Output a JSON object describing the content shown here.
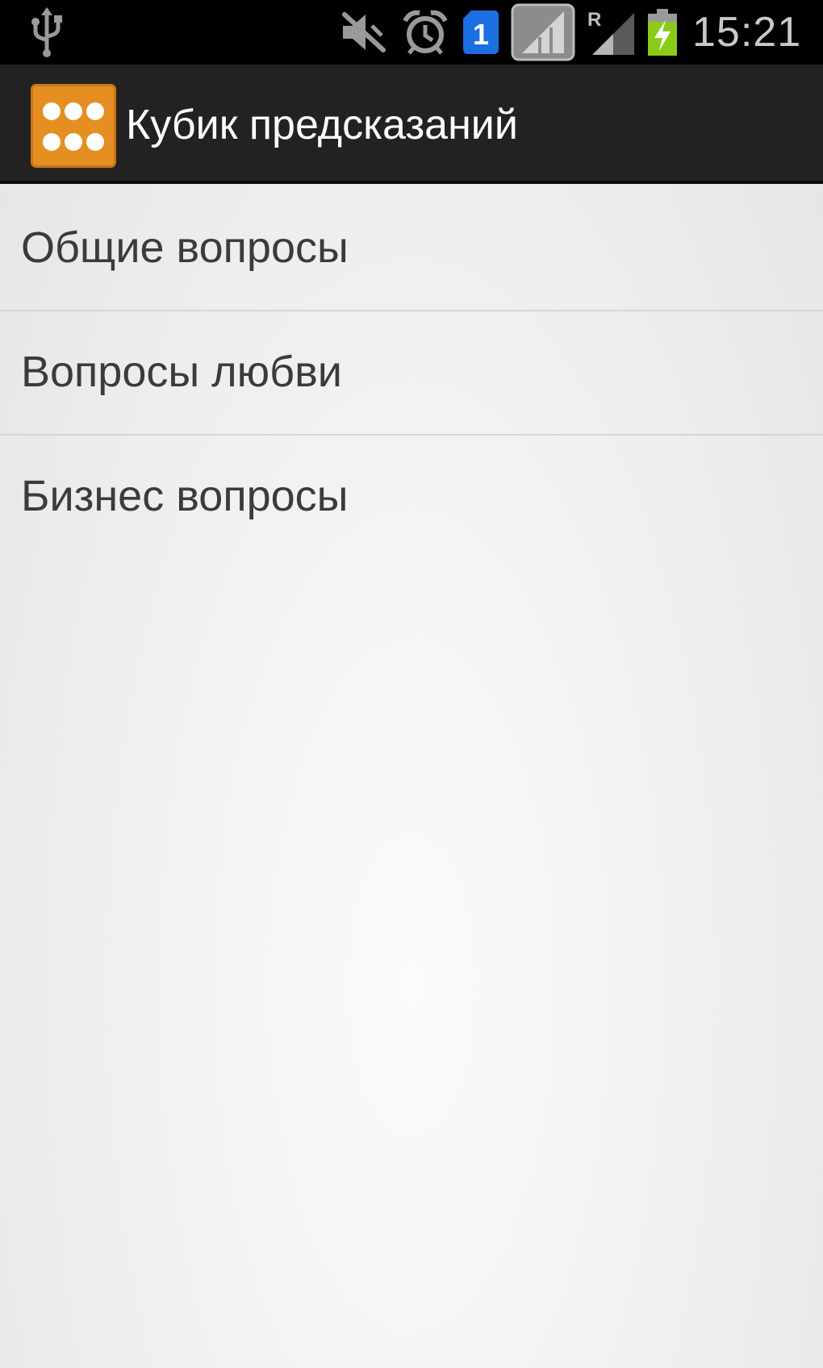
{
  "status_bar": {
    "icons": [
      "usb-icon",
      "mute-icon",
      "alarm-icon",
      "sim-1-icon",
      "signal-icon",
      "signal-roaming-icon",
      "battery-charging-icon"
    ],
    "roaming_label": "R",
    "sim_label": "1",
    "time": "15:21"
  },
  "action_bar": {
    "app_icon": "dice-icon",
    "title": "Кубик предсказаний",
    "accent_color": "#e58e22"
  },
  "list": {
    "items": [
      {
        "label": "Общие вопросы"
      },
      {
        "label": "Вопросы любви"
      },
      {
        "label": "Бизнес вопросы"
      }
    ]
  }
}
